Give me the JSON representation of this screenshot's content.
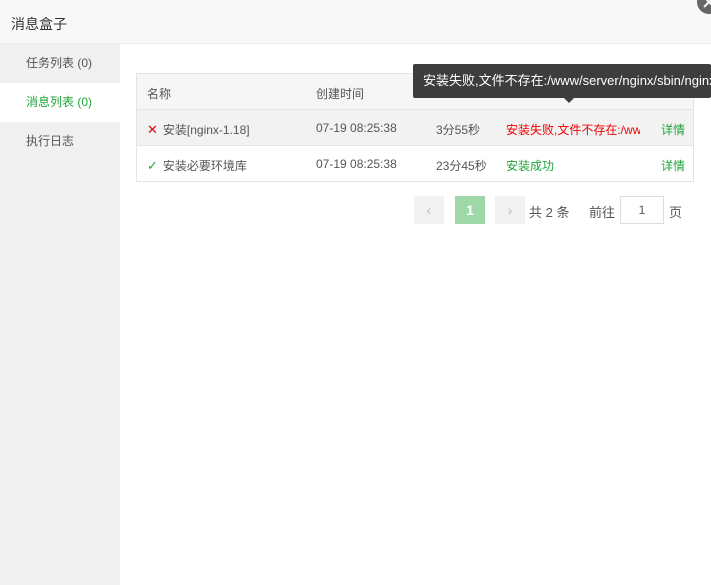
{
  "window": {
    "title": "消息盒子"
  },
  "sidebar": {
    "items": [
      {
        "label": "任务列表 (0)"
      },
      {
        "label": "消息列表 (0)"
      },
      {
        "label": "执行日志"
      }
    ]
  },
  "table": {
    "headers": {
      "name": "名称",
      "created": "创建时间"
    },
    "rows": [
      {
        "icon": "x-icon",
        "name": "安装[nginx-1.18]",
        "created": "07-19 08:25:38",
        "duration": "3分55秒",
        "status": "安装失败,文件不存在:/www/server/nginx/sbin/nginx",
        "action": "详情"
      },
      {
        "icon": "check-icon",
        "name": "安装必要环境库",
        "created": "07-19 08:25:38",
        "duration": "23分45秒",
        "status": "安装成功",
        "action": "详情"
      }
    ]
  },
  "tooltip": {
    "text": "安装失败,文件不存在:/www/server/nginx/sbin/nginx"
  },
  "pagination": {
    "prev": "‹",
    "current_page": "1",
    "next": "›",
    "total": "共 2 条",
    "goto": "前往",
    "page_input": "1",
    "page_suffix": "页"
  },
  "colors": {
    "accent": "#20a53a",
    "error": "#ee0000",
    "tooltip_bg": "#3d3d3d"
  }
}
